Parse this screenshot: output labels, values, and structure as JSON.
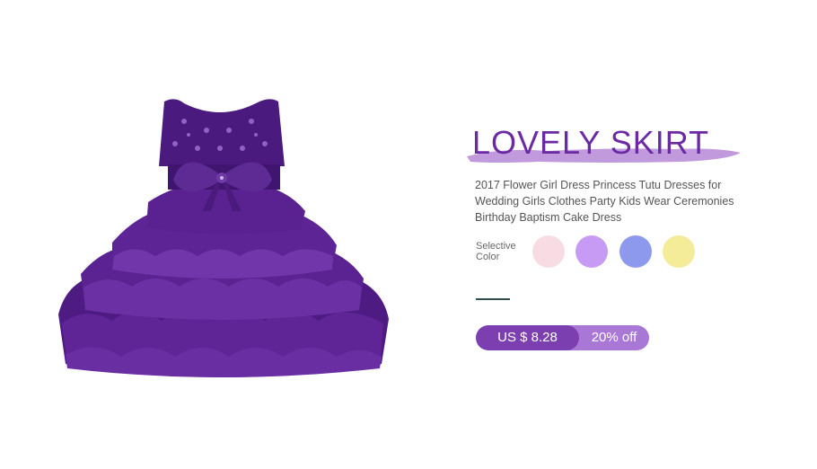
{
  "product": {
    "image": "purple-ruffle-tutu-dress",
    "headline": "LOVELY SKIRT",
    "description": "2017 Flower Girl Dress Princess Tutu Dresses for Wedding Girls Clothes Party Kids Wear Ceremonies Birthday Baptism Cake Dress",
    "colors_label": "Selective Color",
    "colors": [
      {
        "name": "pink",
        "hex": "#f7dde3"
      },
      {
        "name": "lavender",
        "hex": "#c79af3"
      },
      {
        "name": "periwinkle",
        "hex": "#8c99ec"
      },
      {
        "name": "pale-yellow",
        "hex": "#f5ec9a"
      }
    ],
    "price": "US $ 8.28",
    "discount": "20% off"
  },
  "theme": {
    "accent": "#6b2aa3",
    "brush": "#b98fd8",
    "price_dark": "#7b3fb0",
    "price_light": "#a977d6"
  }
}
